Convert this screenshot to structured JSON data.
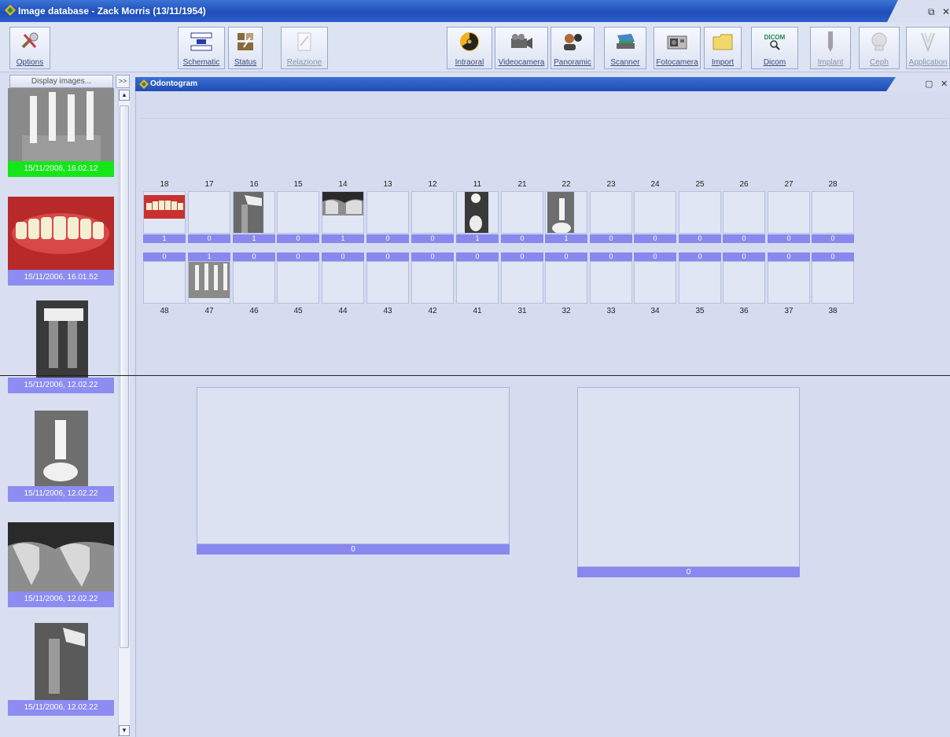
{
  "window": {
    "title": "Image database - Zack Morris (13/11/1954)"
  },
  "toolbar": {
    "options": "Options",
    "schematic": "Schematic",
    "status": "Status",
    "relazione": "Relazione",
    "intraoral": "Intraoral",
    "videocamera": "Videocamera",
    "panoramic": "Panoramic",
    "scanner": "Scanner",
    "fotocamera": "Fotocamera",
    "import": "Import",
    "dicom": "Dicom",
    "dicom_logo": "DICOM",
    "implant": "Implant",
    "ceph": "Ceph",
    "application": "Application"
  },
  "sidebar": {
    "display_button": "Display images...",
    "collapse_button": ">>",
    "thumbnails": [
      {
        "date": "15/11/2006, 16.02.12",
        "status": "green"
      },
      {
        "date": "15/11/2006, 16.01.52",
        "status": "normal"
      },
      {
        "date": "15/11/2006, 12.02.22",
        "status": "normal"
      },
      {
        "date": "15/11/2006, 12.02.22",
        "status": "normal"
      },
      {
        "date": "15/11/2006, 12.02.22",
        "status": "normal"
      },
      {
        "date": "15/11/2006, 12.02.22",
        "status": "normal"
      }
    ]
  },
  "odontogram": {
    "title": "Odontogram",
    "upper": [
      {
        "num": "18",
        "count": "1"
      },
      {
        "num": "17",
        "count": "0"
      },
      {
        "num": "16",
        "count": "1"
      },
      {
        "num": "15",
        "count": "0"
      },
      {
        "num": "14",
        "count": "1"
      },
      {
        "num": "13",
        "count": "0"
      },
      {
        "num": "12",
        "count": "0"
      },
      {
        "num": "11",
        "count": "1"
      },
      {
        "num": "21",
        "count": "0"
      },
      {
        "num": "22",
        "count": "1"
      },
      {
        "num": "23",
        "count": "0"
      },
      {
        "num": "24",
        "count": "0"
      },
      {
        "num": "25",
        "count": "0"
      },
      {
        "num": "26",
        "count": "0"
      },
      {
        "num": "27",
        "count": "0"
      },
      {
        "num": "28",
        "count": "0"
      }
    ],
    "lower": [
      {
        "num": "48",
        "count": "0"
      },
      {
        "num": "47",
        "count": "1"
      },
      {
        "num": "46",
        "count": "0"
      },
      {
        "num": "45",
        "count": "0"
      },
      {
        "num": "44",
        "count": "0"
      },
      {
        "num": "43",
        "count": "0"
      },
      {
        "num": "42",
        "count": "0"
      },
      {
        "num": "41",
        "count": "0"
      },
      {
        "num": "31",
        "count": "0"
      },
      {
        "num": "32",
        "count": "0"
      },
      {
        "num": "33",
        "count": "0"
      },
      {
        "num": "34",
        "count": "0"
      },
      {
        "num": "35",
        "count": "0"
      },
      {
        "num": "36",
        "count": "0"
      },
      {
        "num": "37",
        "count": "0"
      },
      {
        "num": "38",
        "count": "0"
      }
    ],
    "preview_left_count": "0",
    "preview_right_count": "0"
  },
  "colors": {
    "accent": "#8888ee",
    "selected": "#15e61a",
    "titlebar": "#2a5ccc"
  }
}
